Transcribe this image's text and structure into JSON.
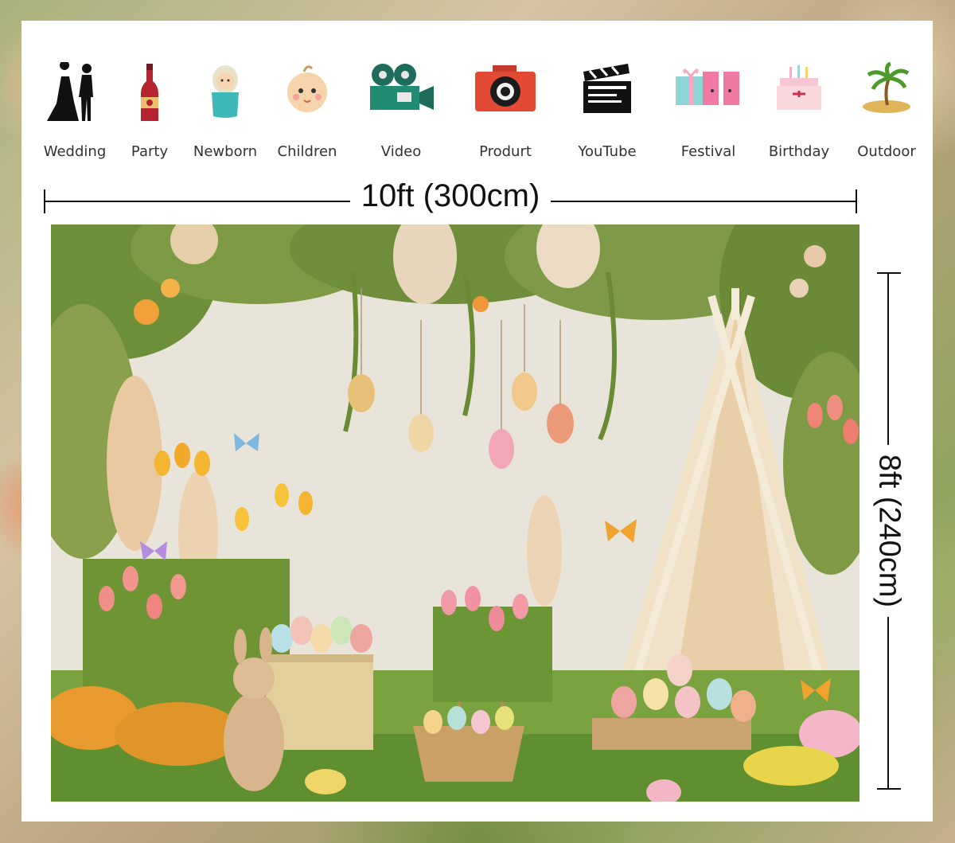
{
  "icons": [
    {
      "name": "wedding-icon",
      "label": "Wedding"
    },
    {
      "name": "party-icon",
      "label": "Party"
    },
    {
      "name": "newborn-icon",
      "label": "Newborn"
    },
    {
      "name": "children-icon",
      "label": "Children"
    },
    {
      "name": "video-camera-icon",
      "label": "Video"
    },
    {
      "name": "camera-icon",
      "label": "Produrt"
    },
    {
      "name": "clapperboard-icon",
      "label": "YouTube"
    },
    {
      "name": "gift-icon",
      "label": "Festival"
    },
    {
      "name": "cake-icon",
      "label": "Birthday"
    },
    {
      "name": "island-icon",
      "label": "Outdoor"
    }
  ],
  "dimensions": {
    "width_label": "10ft (300cm)",
    "height_label": "8ft (240cm)"
  },
  "scene": {
    "description_name": "easter-backdrop",
    "colors": {
      "wall": "#e9e4da",
      "grass": "#6f9937",
      "tent": "#efe2c8",
      "tulip_pink": "#f08f8a",
      "tulip_yellow": "#f4b630"
    }
  }
}
